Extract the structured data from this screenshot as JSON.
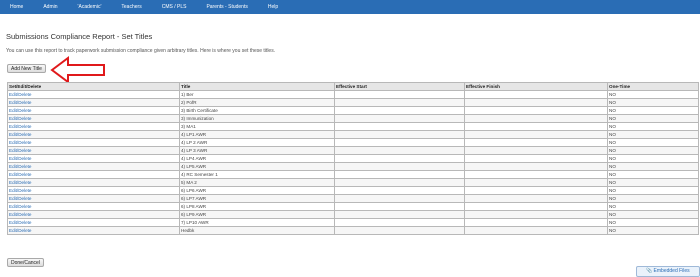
{
  "nav": {
    "items": [
      {
        "label": "Home"
      },
      {
        "label": "Admin"
      },
      {
        "label": "'Academic'"
      },
      {
        "label": "Teachers"
      },
      {
        "label": "CMS / PLS"
      },
      {
        "label": "Parents - Students"
      },
      {
        "label": "Help"
      }
    ]
  },
  "page": {
    "title": "Submissions Compliance Report - Set Titles",
    "description": "You can use this report to track paperwork submission compliance given arbitrary titles. Here is where you set these titles."
  },
  "buttons": {
    "add_new_title": "Add New Title",
    "done_cancel": "Done/Cancel",
    "embedded_files": "Embedded Files"
  },
  "colors": {
    "nav_bg": "#2a6db5",
    "arrow": "#e0191b",
    "link": "#2a6db5"
  },
  "icons": {
    "embedded": "paperclip-icon",
    "annotation": "red-arrow-icon"
  },
  "table": {
    "columns": [
      "Set/Edit/Delete",
      "Title",
      "Effective Start",
      "Effective Finish",
      "One-Time"
    ],
    "rows": [
      {
        "action": "Edit/Delete",
        "title": "1) Ber",
        "start": "",
        "finish": "",
        "one_time": "NO"
      },
      {
        "action": "Edit/Delete",
        "title": "2) PofR",
        "start": "",
        "finish": "",
        "one_time": "NO"
      },
      {
        "action": "Edit/Delete",
        "title": "3) Birth Certificate",
        "start": "",
        "finish": "",
        "one_time": "NO"
      },
      {
        "action": "Edit/Delete",
        "title": "3) Immunization",
        "start": "",
        "finish": "",
        "one_time": "NO"
      },
      {
        "action": "Edit/Delete",
        "title": "3) MA1",
        "start": "",
        "finish": "",
        "one_time": "NO"
      },
      {
        "action": "Edit/Delete",
        "title": "4) LP1 AWR",
        "start": "",
        "finish": "",
        "one_time": "NO"
      },
      {
        "action": "Edit/Delete",
        "title": "4) LP 2 AWR",
        "start": "",
        "finish": "",
        "one_time": "NO"
      },
      {
        "action": "Edit/Delete",
        "title": "4) LP 3 AWR",
        "start": "",
        "finish": "",
        "one_time": "NO"
      },
      {
        "action": "Edit/Delete",
        "title": "4) LP4 AWR",
        "start": "",
        "finish": "",
        "one_time": "NO"
      },
      {
        "action": "Edit/Delete",
        "title": "4) LP5 AWR",
        "start": "",
        "finish": "",
        "one_time": "NO"
      },
      {
        "action": "Edit/Delete",
        "title": "4) RC Semester 1",
        "start": "",
        "finish": "",
        "one_time": "NO"
      },
      {
        "action": "Edit/Delete",
        "title": "5) MA 2",
        "start": "",
        "finish": "",
        "one_time": "NO"
      },
      {
        "action": "Edit/Delete",
        "title": "6) LP6 AWR",
        "start": "",
        "finish": "",
        "one_time": "NO"
      },
      {
        "action": "Edit/Delete",
        "title": "6) LP7 AWR",
        "start": "",
        "finish": "",
        "one_time": "NO"
      },
      {
        "action": "Edit/Delete",
        "title": "6) LP8 AWR",
        "start": "",
        "finish": "",
        "one_time": "NO"
      },
      {
        "action": "Edit/Delete",
        "title": "6) LP9 AWR",
        "start": "",
        "finish": "",
        "one_time": "NO"
      },
      {
        "action": "Edit/Delete",
        "title": "7) LP10 AWR",
        "start": "",
        "finish": "",
        "one_time": "NO"
      },
      {
        "action": "Edit/Delete",
        "title": "Hedbk",
        "start": "",
        "finish": "",
        "one_time": "NO"
      }
    ]
  }
}
